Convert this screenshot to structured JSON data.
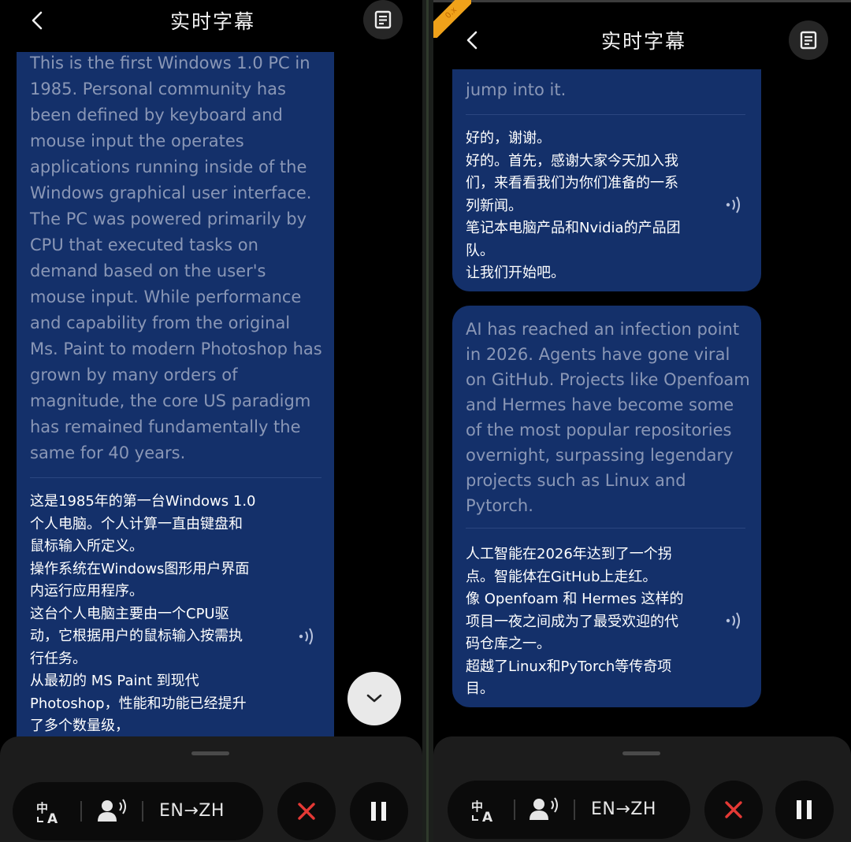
{
  "title": "实时字幕",
  "left": {
    "card": {
      "english": "This is the first Windows 1.0 PC in 1985. Personal community has been defined by keyboard and mouse input the operates applications running inside of the Windows graphical user interface. The PC was powered primarily by CPU that executed tasks on demand based on the user's mouse input. While performance and capability from the original Ms. Paint to modern Photoshop has grown by many orders of magnitude, the core US paradigm has remained fundamentally the same for 40 years.",
      "chinese_lines": [
        "这是1985年的第一台Windows 1.0",
        "个人电脑。个人计算一直由键盘和",
        "鼠标输入所定义。",
        "操作系统在Windows图形用户界面",
        "内运行应用程序。",
        "这台个人电脑主要由一个CPU驱",
        "动，它根据用户的鼠标输入按需执",
        "行任务。",
        "从最初的 MS Paint 到现代",
        "Photoshop，性能和功能已经提升",
        "了多个数量级，"
      ]
    }
  },
  "right": {
    "badge": "0.x",
    "card1": {
      "english_tail": "jump into it.",
      "chinese_lines": [
        "好的，谢谢。",
        "好的。首先，感谢大家今天加入我",
        "们，来看看我们为你们准备的一系",
        "列新闻。",
        "笔记本电脑产品和Nvidia的产品团",
        "队。",
        "让我们开始吧。"
      ]
    },
    "card2": {
      "english": "AI has reached an infection point in 2026. Agents have gone viral on GitHub. Projects like Openfoam and Hermes have become some of the most popular repositories overnight, surpassing legendary projects such as Linux and Pytorch.",
      "chinese_lines": [
        "人工智能在2026年达到了一个拐",
        "点。智能体在GitHub上走红。",
        "像 Openfoam 和 Hermes 这样的",
        "项目一夜之间成为了最受欢迎的代",
        "码仓库之一。",
        "超越了Linux和PyTorch等传奇项",
        "目。"
      ]
    }
  },
  "controls": {
    "language_pair": "EN→ZH",
    "icons": [
      "translate-icon",
      "speaker-voice-icon",
      "stop-icon",
      "pause-icon"
    ],
    "colors": {
      "card": "#14306a",
      "stop": "#e53935"
    }
  }
}
